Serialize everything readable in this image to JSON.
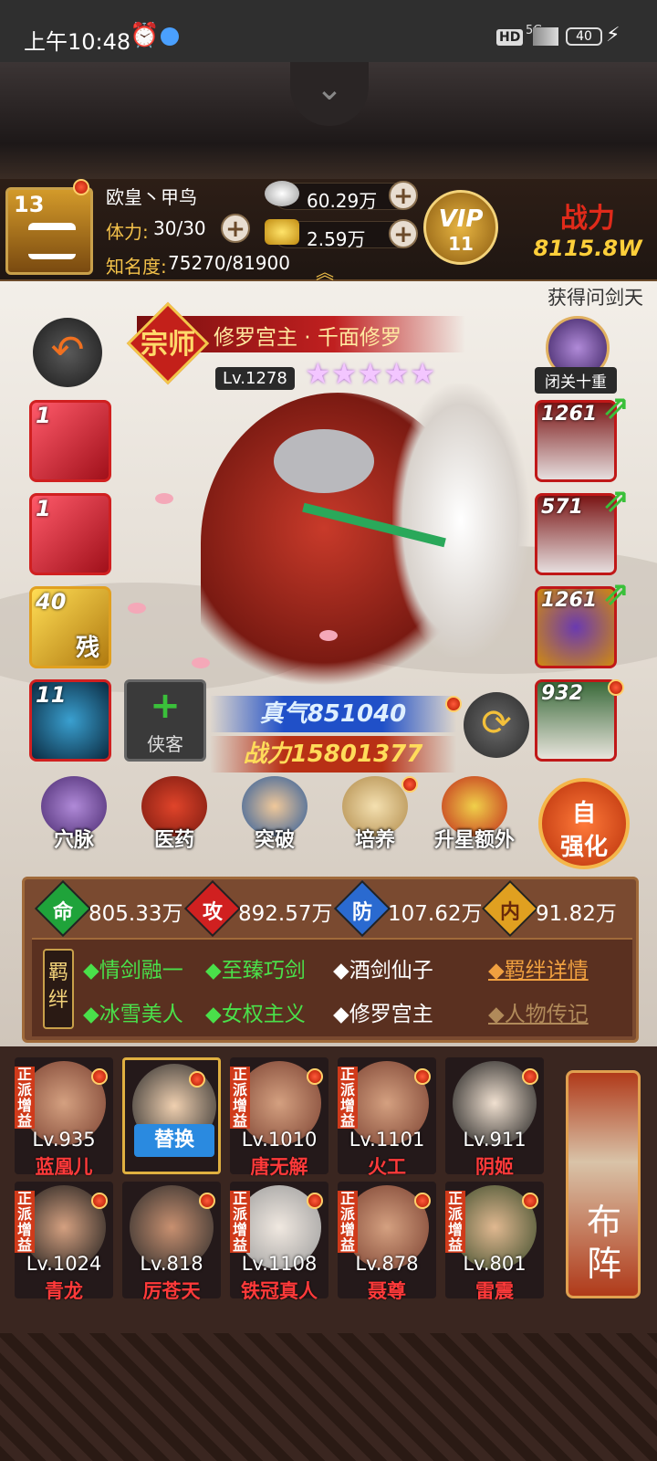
{
  "status_bar": {
    "time": "上午10:48",
    "hd": "HD",
    "network": "5G",
    "battery": "40"
  },
  "player": {
    "level": "13",
    "name": "欧皇丶甲鸟",
    "stamina_label": "体力:",
    "stamina": "30/30",
    "fame_label": "知名度:",
    "fame": "75270/81900",
    "silver": "60.29万",
    "gold": "2.59万",
    "vip_label": "VIP",
    "vip_level": "11",
    "power_label": "战力",
    "power": "8115.8W"
  },
  "marquee": "获得问剑天",
  "hero": {
    "badge": "宗师",
    "title": "修罗宫主 · 千面修罗",
    "level": "Lv.1278",
    "stars": [
      "★",
      "★",
      "★",
      "★",
      "★"
    ],
    "mentor_label": "闭关十重",
    "zhenqi": "真气851040",
    "zhanli": "战力15801377",
    "xiake_label": "侠客",
    "xiake_plus": "+"
  },
  "left_slots": [
    {
      "count": "1"
    },
    {
      "count": "1"
    },
    {
      "count": "40",
      "overlay": "残"
    },
    {
      "count": "11"
    }
  ],
  "right_slots": [
    {
      "count": "1261"
    },
    {
      "count": "571"
    },
    {
      "count": "1261"
    },
    {
      "count": "932"
    }
  ],
  "functions": [
    {
      "label": "穴脉"
    },
    {
      "label": "医药"
    },
    {
      "label": "突破"
    },
    {
      "label": "培养"
    },
    {
      "label": "升星额外"
    }
  ],
  "auto_enhance": {
    "line1": "自",
    "line2": "强化"
  },
  "stats": [
    {
      "icon": "命",
      "value": "805.33万",
      "color": "#1fa33a"
    },
    {
      "icon": "攻",
      "value": "892.57万",
      "color": "#d02020"
    },
    {
      "icon": "防",
      "value": "107.62万",
      "color": "#2a6ad0"
    },
    {
      "icon": "内",
      "value": "91.82万",
      "color": "#e0a020"
    }
  ],
  "bonds": {
    "label": "羁绊",
    "row1": [
      "◆情剑融一",
      "◆至臻巧剑",
      "◆酒剑仙子"
    ],
    "row2": [
      "◆冰雪美人",
      "◆女权主义",
      "◆修罗宫主"
    ],
    "detail": "◆羁绊详情",
    "bio": "◆人物传记"
  },
  "team": [
    {
      "level": "Lv.935",
      "name": "蓝凰儿",
      "tag": "正派增益"
    },
    {
      "level": "",
      "name": "",
      "tag": "",
      "swap": "替换"
    },
    {
      "level": "Lv.1010",
      "name": "唐无解",
      "tag": "正派增益"
    },
    {
      "level": "Lv.1101",
      "name": "火工",
      "tag": "正派增益"
    },
    {
      "level": "Lv.911",
      "name": "阴姬",
      "tag": ""
    },
    {
      "level": "Lv.1024",
      "name": "青龙",
      "tag": "正派增益"
    },
    {
      "level": "Lv.818",
      "name": "厉苍天",
      "tag": ""
    },
    {
      "level": "Lv.1108",
      "name": "铁冠真人",
      "tag": "正派增益"
    },
    {
      "level": "Lv.878",
      "name": "聂尊",
      "tag": "正派增益"
    },
    {
      "level": "Lv.801",
      "name": "雷震",
      "tag": "正派增益"
    }
  ],
  "formation": "布阵"
}
